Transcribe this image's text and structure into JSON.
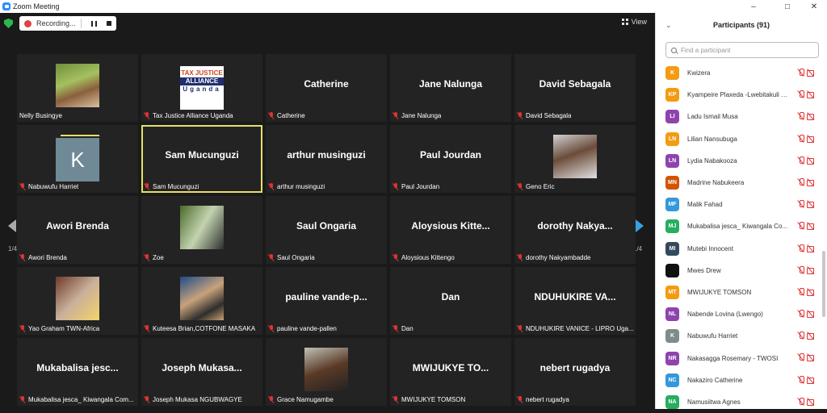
{
  "window": {
    "title": "Zoom Meeting"
  },
  "recording": {
    "label": "Recording..."
  },
  "view_label": "View",
  "page_indicator": "1/4",
  "tiles": [
    {
      "name": "Nelly Busingye",
      "big": "",
      "kind": "photo",
      "photo": "ph1",
      "muted": false
    },
    {
      "name": "Tax Justice Alliance Uganda",
      "big": "",
      "kind": "logo",
      "muted": true
    },
    {
      "name": "Catherine",
      "big": "Catherine",
      "kind": "text",
      "muted": true
    },
    {
      "name": "Jane Nalunga",
      "big": "Jane Nalunga",
      "kind": "text",
      "muted": true
    },
    {
      "name": "David Sebagala",
      "big": "David Sebagala",
      "kind": "text",
      "muted": true
    },
    {
      "name": "Nabuwufu Harriet",
      "big": "",
      "kind": "initial",
      "initial": "K",
      "muted": true
    },
    {
      "name": "Sam Mucunguzi",
      "big": "Sam Mucunguzi",
      "kind": "text",
      "muted": true,
      "active": true
    },
    {
      "name": "arthur musinguzi",
      "big": "arthur musinguzi",
      "kind": "text",
      "muted": true
    },
    {
      "name": "Paul Jourdan",
      "big": "Paul Jourdan",
      "kind": "text",
      "muted": true
    },
    {
      "name": "Geno Eric",
      "big": "",
      "kind": "photo",
      "photo": "ph5",
      "muted": true
    },
    {
      "name": "Awori Brenda",
      "big": "Awori Brenda",
      "kind": "text",
      "muted": true
    },
    {
      "name": "Zoe",
      "big": "",
      "kind": "photo",
      "photo": "ph4",
      "muted": true
    },
    {
      "name": "Saul Ongaria",
      "big": "Saul Ongaria",
      "kind": "text",
      "muted": true
    },
    {
      "name": "Aloysious Kittengo",
      "big": "Aloysious  Kitte...",
      "kind": "text",
      "muted": true
    },
    {
      "name": "dorothy Nakyambadde",
      "big": "dorothy  Nakya...",
      "kind": "text",
      "muted": true
    },
    {
      "name": "Yao Graham TWN-Africa",
      "big": "",
      "kind": "photo",
      "photo": "ph2",
      "muted": true
    },
    {
      "name": "Kuteesa Brian,COTFONE MASAKA",
      "big": "",
      "kind": "photo",
      "photo": "ph3",
      "muted": true
    },
    {
      "name": "pauline vande-pallen",
      "big": "pauline  vande-p...",
      "kind": "text",
      "muted": true
    },
    {
      "name": "Dan",
      "big": "Dan",
      "kind": "text",
      "muted": true
    },
    {
      "name": "NDUHUKIRE VANICE - LIPRO Uga...",
      "big": "NDUHUKIRE  VA...",
      "kind": "text",
      "muted": true
    },
    {
      "name": "Mukabalisa jesca_ Kiwangala Com...",
      "big": "Mukabalisa  jesc...",
      "kind": "text",
      "muted": true
    },
    {
      "name": "Joseph Mukasa NGUBWAGYE",
      "big": "Joseph  Mukasa...",
      "kind": "text",
      "muted": true
    },
    {
      "name": "Grace Namugambe",
      "big": "",
      "kind": "photo",
      "photo": "ph6",
      "muted": true
    },
    {
      "name": "MWIJUKYE TOMSON",
      "big": "MWIJUKYE  TO...",
      "kind": "text",
      "muted": true
    },
    {
      "name": "nebert rugadya",
      "big": "nebert rugadya",
      "kind": "text",
      "muted": true
    }
  ],
  "logo_text": {
    "l1": "TAX JUSTICE",
    "l2": "ALLIANCE",
    "l3": "Uganda"
  },
  "participants": {
    "title": "Participants (91)",
    "search_placeholder": "Find a participant",
    "list": [
      {
        "initials": "K",
        "name": "Kwizera",
        "color": "#f39c12"
      },
      {
        "initials": "KP",
        "name": "Kyampeire Plaxeda -Lwebitakuli C...",
        "color": "#f39c12"
      },
      {
        "initials": "LI",
        "name": "Ladu Ismail Musa",
        "color": "#8e44ad"
      },
      {
        "initials": "LN",
        "name": "Lilian Nansubuga",
        "color": "#f39c12"
      },
      {
        "initials": "LN",
        "name": "Lydia Nabakooza",
        "color": "#8e44ad"
      },
      {
        "initials": "MN",
        "name": "Madrine Nabukeera",
        "color": "#d35400"
      },
      {
        "initials": "MF",
        "name": "Malik Fahad",
        "color": "#3498db"
      },
      {
        "initials": "MJ",
        "name": "Mukabalisa jesca_ Kiwangala Co...",
        "color": "#27ae60"
      },
      {
        "initials": "MI",
        "name": "Mutebi Innocent",
        "color": "#34495e"
      },
      {
        "initials": "",
        "name": "Mwes Drew",
        "color": "#111111"
      },
      {
        "initials": "MT",
        "name": "MWIJUKYE TOMSON",
        "color": "#f39c12"
      },
      {
        "initials": "NL",
        "name": "Nabende Lovina (Lwengo)",
        "color": "#8e44ad"
      },
      {
        "initials": "K",
        "name": "Nabuwufu Harriet",
        "color": "#7f8c8d"
      },
      {
        "initials": "NR",
        "name": "Nakasagga Rosemary - TWOSI",
        "color": "#8e44ad"
      },
      {
        "initials": "NC",
        "name": "Nakaziro Catherine",
        "color": "#3498db"
      },
      {
        "initials": "NA",
        "name": "Namusiitwa Agnes",
        "color": "#27ae60"
      }
    ]
  }
}
